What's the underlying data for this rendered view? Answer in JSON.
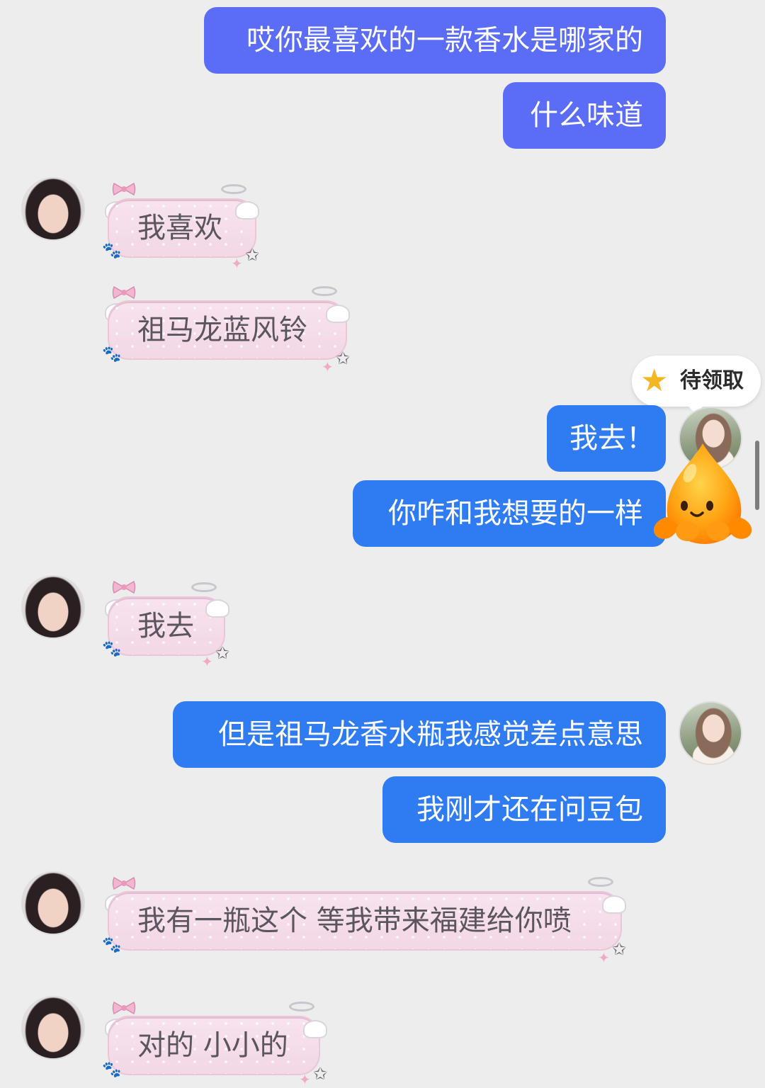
{
  "messages": {
    "m1": "哎你最喜欢的一款香水是哪家的",
    "m2": "什么味道",
    "m3": "我喜欢",
    "m4": "祖马龙蓝风铃",
    "m5": "我去！",
    "m6": "你咋和我想要的一样",
    "m7": "我去",
    "m8": "但是祖马龙香水瓶我感觉差点意思",
    "m9": "我刚才还在问豆包",
    "m10": "我有一瓶这个 等我带来福建给你喷",
    "m11": "对的 小小的"
  },
  "reward": {
    "label": "待领取",
    "icon": "star-icon"
  },
  "icons": {
    "mascot": "doubao-mascot-icon",
    "paw": "paw-icon",
    "bow": "bow-icon",
    "halo": "halo-icon",
    "wing": "wing-icon"
  },
  "colors": {
    "outgoing": "#2f7bf2",
    "outgoing_alt": "#5b6cf7",
    "incoming": "#f4d9e7",
    "background": "#ededed"
  }
}
